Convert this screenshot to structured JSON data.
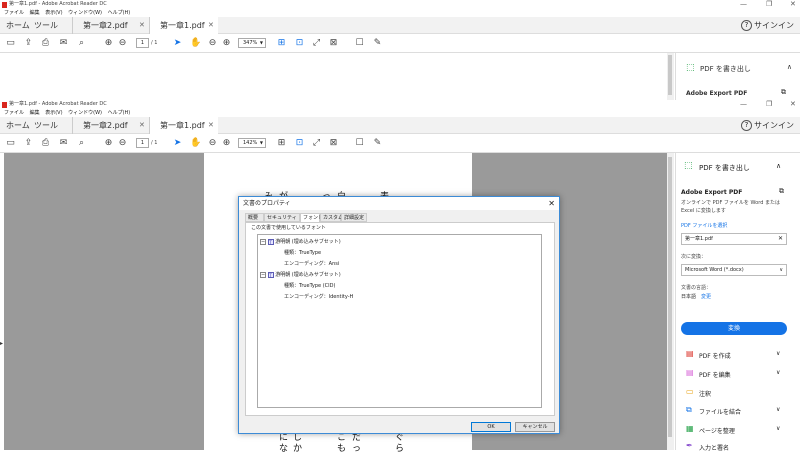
{
  "back_window": {
    "title": "第一章1.pdf - Adobe Acrobat Reader DC",
    "menu": [
      "ファイル",
      "編集",
      "表示(V)",
      "ウィンドウ(W)",
      "ヘルプ(H)"
    ],
    "tabs": {
      "home": "ホーム",
      "tools": "ツール",
      "file1": "第一章2.pdf",
      "file2": "第一章1.pdf"
    },
    "page_current": "1",
    "page_total": "/ 1",
    "zoom": "347%",
    "signin": "サインイン",
    "right_panel": {
      "export_label": "PDF を書き出し",
      "adobe_export": "Adobe Export PDF"
    }
  },
  "front_window": {
    "title": "第一章1.pdf - Adobe Acrobat Reader DC",
    "menu": [
      "ファイル",
      "編集",
      "表示(V)",
      "ウィンドウ(W)",
      "ヘルプ(H)"
    ],
    "tabs": {
      "home": "ホーム",
      "tools": "ツール",
      "file1": "第一章2.pdf",
      "file2": "第一章1.pdf"
    },
    "page_current": "1",
    "page_total": "/ 1",
    "zoom": "142%",
    "signin": "サインイン"
  },
  "right_panel": {
    "export_label": "PDF を書き出し",
    "adobe_export": "Adobe Export PDF",
    "description": "オンラインで PDF ファイルを Word または Excel に変換します",
    "select_file": "PDF ファイルを選択",
    "file_name": "第一章1.pdf",
    "convert_to_label": "次に変換：",
    "convert_to_value": "Microsoft Word (*.docx)",
    "doc_lang_label": "文書の言語：",
    "doc_lang_value": "日本語",
    "change_link": "変更",
    "convert_button": "変換",
    "tools": [
      {
        "label": "PDF を作成",
        "icon": "create-pdf-icon"
      },
      {
        "label": "PDF を編集",
        "icon": "edit-pdf-icon"
      },
      {
        "label": "注釈",
        "icon": "comment-icon"
      },
      {
        "label": "ファイルを結合",
        "icon": "combine-icon"
      },
      {
        "label": "ページを整理",
        "icon": "organize-icon"
      },
      {
        "label": "入力と署名",
        "icon": "fill-sign-icon"
      }
    ]
  },
  "page_text": {
    "top": [
      "み",
      "が",
      "っ",
      "白",
      "表"
    ],
    "bottom_col1": [
      "に",
      "な"
    ],
    "bottom_col2": [
      "し",
      "か"
    ],
    "bottom_col3": [
      "こ",
      "も"
    ],
    "bottom_col4": [
      "だ",
      "っ"
    ],
    "bottom_col5": [
      "ぐ",
      "ら"
    ]
  },
  "dialog": {
    "title": "文書のプロパティ",
    "tabs": [
      "概要",
      "セキュリティ",
      "フォント",
      "カスタム",
      "詳細設定"
    ],
    "section_label": "この文書で使用しているフォント",
    "fonts": [
      {
        "name": "游明朝 (埋め込みサブセット)",
        "type": "種類：TrueType",
        "encoding": "エンコーディング：Ansi"
      },
      {
        "name": "游明朝 (埋め込みサブセット)",
        "type": "種類：TrueType (CID)",
        "encoding": "エンコーディング：Identity-H"
      }
    ],
    "ok": "OK",
    "cancel": "キャンセル"
  }
}
